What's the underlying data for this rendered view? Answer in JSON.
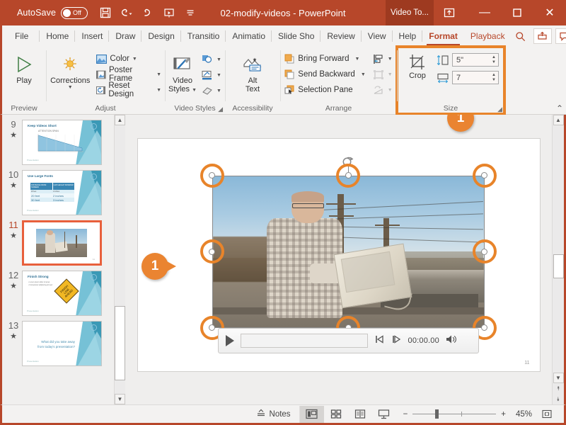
{
  "titlebar": {
    "autosave_label": "AutoSave",
    "autosave_state": "Off",
    "document_title": "02-modify-videos  -  PowerPoint",
    "contextual_tab": "Video To...",
    "icons": {
      "save": "save-icon",
      "undo": "undo-icon",
      "redo": "redo-icon",
      "present": "start-presentation-icon",
      "more": "customize-quick-access-icon",
      "ribbon_display": "ribbon-display-options-icon"
    },
    "window_controls": {
      "minimize": "—",
      "maximize": "▢",
      "close": "✕"
    }
  },
  "tabs": [
    {
      "label": "File",
      "active": false
    },
    {
      "label": "Home",
      "active": false
    },
    {
      "label": "Insert",
      "active": false
    },
    {
      "label": "Draw",
      "active": false
    },
    {
      "label": "Design",
      "active": false
    },
    {
      "label": "Transitio",
      "active": false
    },
    {
      "label": "Animatio",
      "active": false
    },
    {
      "label": "Slide Sho",
      "active": false
    },
    {
      "label": "Review",
      "active": false
    },
    {
      "label": "View",
      "active": false
    },
    {
      "label": "Help",
      "active": false
    },
    {
      "label": "Format",
      "active": true
    },
    {
      "label": "Playback",
      "active": false
    }
  ],
  "tabbar_right": {
    "search": "search-icon",
    "share": "share-icon",
    "comments": "comments-icon"
  },
  "ribbon": {
    "groups": [
      {
        "name": "Preview",
        "label": "Preview",
        "items": [
          {
            "label": "Play",
            "icon": "play-triangle-icon"
          }
        ]
      },
      {
        "name": "Adjust",
        "label": "Adjust",
        "items": [
          {
            "label": "Corrections",
            "icon": "brightness-sun-icon"
          },
          {
            "label": "Color",
            "icon": "color-picture-icon"
          },
          {
            "label": "Poster Frame",
            "icon": "poster-frame-icon"
          },
          {
            "label": "Reset Design",
            "icon": "reset-design-icon"
          }
        ]
      },
      {
        "name": "Video Styles",
        "label": "Video Styles",
        "items": [
          {
            "label": "Video Styles",
            "icon": "video-styles-brush-icon"
          },
          {
            "label": "Video Shape",
            "icon": "video-shape-icon"
          },
          {
            "label": "Video Border",
            "icon": "video-border-icon"
          },
          {
            "label": "Video Effects",
            "icon": "video-effects-icon"
          }
        ]
      },
      {
        "name": "Accessibility",
        "label": "Accessibility",
        "items": [
          {
            "label": "Alt Text",
            "icon": "alt-text-icon"
          }
        ]
      },
      {
        "name": "Arrange",
        "label": "Arrange",
        "items": [
          {
            "label": "Bring Forward",
            "icon": "bring-forward-icon"
          },
          {
            "label": "Send Backward",
            "icon": "send-backward-icon"
          },
          {
            "label": "Selection Pane",
            "icon": "selection-pane-icon"
          },
          {
            "label": "Align",
            "icon": "align-icon"
          },
          {
            "label": "Group",
            "icon": "group-icon"
          },
          {
            "label": "Rotate",
            "icon": "rotate-icon"
          }
        ]
      },
      {
        "name": "Size",
        "label": "Size",
        "highlighted": true,
        "items": [
          {
            "label": "Crop",
            "icon": "crop-icon"
          }
        ],
        "fields": [
          {
            "name": "video-height",
            "icon": "height-icon",
            "value": "5\""
          },
          {
            "name": "video-width",
            "icon": "width-icon",
            "value": "7"
          }
        ]
      }
    ],
    "collapse_icon": "collapse-ribbon-icon"
  },
  "thumbnails": [
    {
      "number": "9",
      "title": "Keep Videos Short",
      "selected": false,
      "kind": "chart",
      "chart_title": "ATTENTION SPAN"
    },
    {
      "number": "10",
      "title": "Use Large Fonts",
      "selected": false,
      "kind": "table",
      "table": [
        [
          "DISTANCE FROM SCREEN",
          "CAP HEIGHT"
        ],
        [
          "20 feet",
          "2 inches"
        ],
        [
          "30 feet",
          "3 inches"
        ]
      ]
    },
    {
      "number": "11",
      "title": "",
      "selected": true,
      "kind": "video"
    },
    {
      "number": "12",
      "title": "Finish Strong",
      "selected": false,
      "kind": "sign",
      "sign_text": "FINISH LINE AHEAD"
    },
    {
      "number": "13",
      "title": "What did you take away from today's presentation?",
      "selected": false,
      "kind": "text"
    }
  ],
  "slide": {
    "number_label": "11",
    "video": {
      "player": {
        "play_icon": "play-icon",
        "step_back_icon": "step-backward-icon",
        "step_forward_icon": "step-forward-icon",
        "timecode": "00:00.00",
        "volume_icon": "volume-icon"
      },
      "rotate_handle_icon": "rotate-handle-icon"
    }
  },
  "callouts": [
    {
      "id": "callout-size-group",
      "number": "1",
      "direction": "up"
    },
    {
      "id": "callout-handle",
      "number": "1",
      "direction": "right"
    }
  ],
  "statusbar": {
    "notes_label": "Notes",
    "notes_icon": "notes-icon",
    "views": [
      {
        "name": "normal-view",
        "icon": "normal-view-icon",
        "active": true
      },
      {
        "name": "slide-sorter-view",
        "icon": "slide-sorter-icon",
        "active": false
      },
      {
        "name": "reading-view",
        "icon": "reading-view-icon",
        "active": false
      },
      {
        "name": "slide-show-view",
        "icon": "slide-show-icon",
        "active": false
      }
    ],
    "zoom_out": "−",
    "zoom_in": "+",
    "zoom_value": "45%",
    "fit_icon": "fit-slide-icon"
  },
  "colors": {
    "brand": "#b7472a",
    "accent_orange": "#ea8431",
    "selection_border": "#e8603c",
    "ribbon_bg": "#f3f2f1"
  }
}
